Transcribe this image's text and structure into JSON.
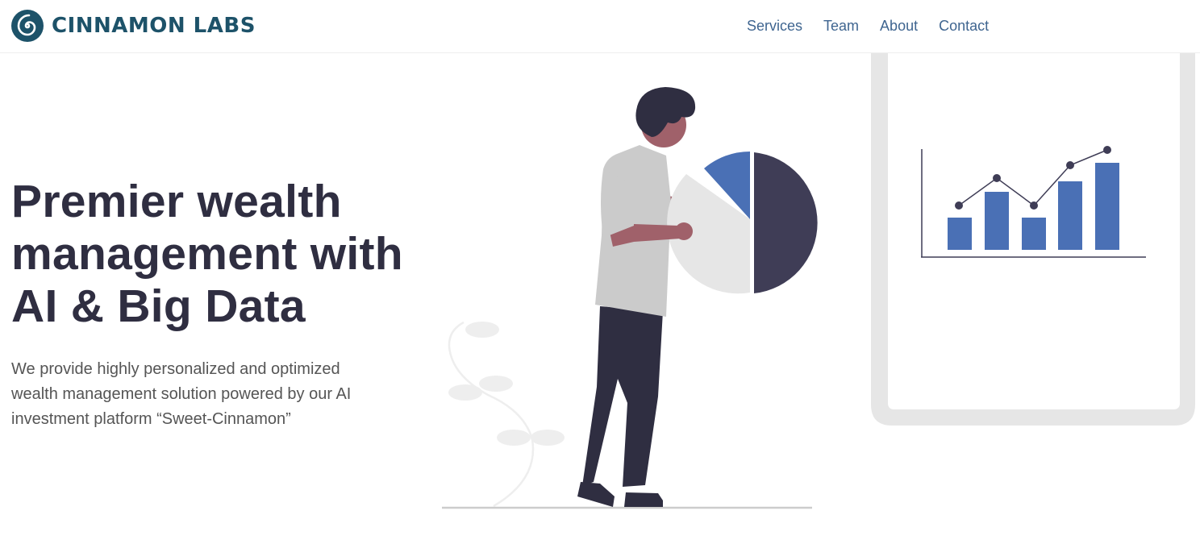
{
  "header": {
    "brand_name": "CINNAMON LABS",
    "logo_icon": "spiral-icon",
    "nav": [
      {
        "label": "Services"
      },
      {
        "label": "Team"
      },
      {
        "label": "About"
      },
      {
        "label": "Contact"
      }
    ]
  },
  "hero": {
    "title_lines": [
      "Premier wealth",
      "management with",
      "AI & Big Data"
    ],
    "description": "We provide highly personalized and optimized wealth management solution powered by our AI investment platform “Sweet-Cinnamon”"
  },
  "colors": {
    "brand": "#1d5269",
    "nav_link": "#3f6590",
    "heading": "#2f2e41",
    "body_text": "#555555",
    "accent_blue": "#4a70b5",
    "dark": "#3f3d56",
    "light_gray": "#e6e6e6"
  }
}
